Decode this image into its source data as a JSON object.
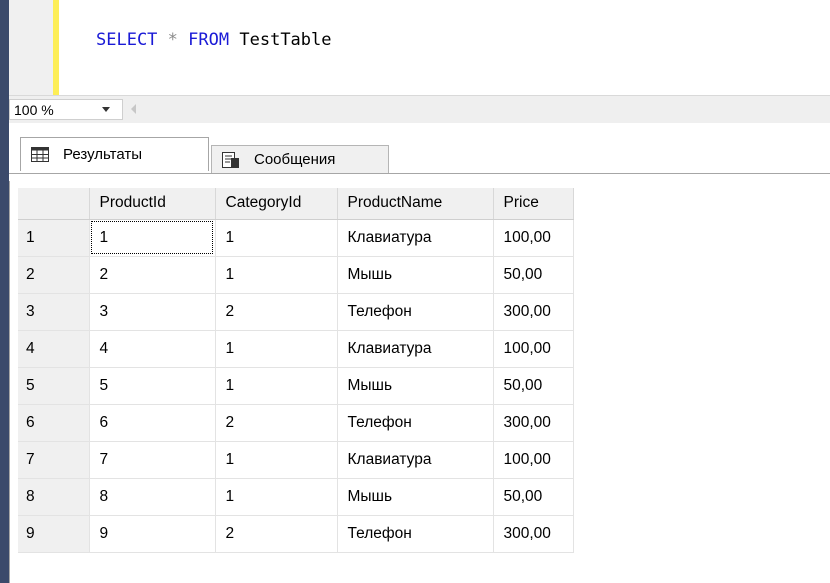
{
  "editor": {
    "sql": {
      "kw1": "SELECT",
      "star": "*",
      "kw2": "FROM",
      "table": "TestTable"
    }
  },
  "zoom": {
    "value": "100 %"
  },
  "tabs": [
    {
      "label": "Результаты",
      "icon": "grid-icon",
      "active": true
    },
    {
      "label": "Сообщения",
      "icon": "messages-icon",
      "active": false
    }
  ],
  "grid": {
    "columns": [
      "",
      "ProductId",
      "CategoryId",
      "ProductName",
      "Price"
    ],
    "rows": [
      [
        "1",
        "1",
        "1",
        "Клавиатура",
        "100,00"
      ],
      [
        "2",
        "2",
        "1",
        "Мышь",
        "50,00"
      ],
      [
        "3",
        "3",
        "2",
        "Телефон",
        "300,00"
      ],
      [
        "4",
        "4",
        "1",
        "Клавиатура",
        "100,00"
      ],
      [
        "5",
        "5",
        "1",
        "Мышь",
        "50,00"
      ],
      [
        "6",
        "6",
        "2",
        "Телефон",
        "300,00"
      ],
      [
        "7",
        "7",
        "1",
        "Клавиатура",
        "100,00"
      ],
      [
        "8",
        "8",
        "1",
        "Мышь",
        "50,00"
      ],
      [
        "9",
        "9",
        "2",
        "Телефон",
        "300,00"
      ]
    ]
  },
  "colors": {
    "keyword": "#1a1ad6",
    "change_bar": "#fdee57"
  }
}
